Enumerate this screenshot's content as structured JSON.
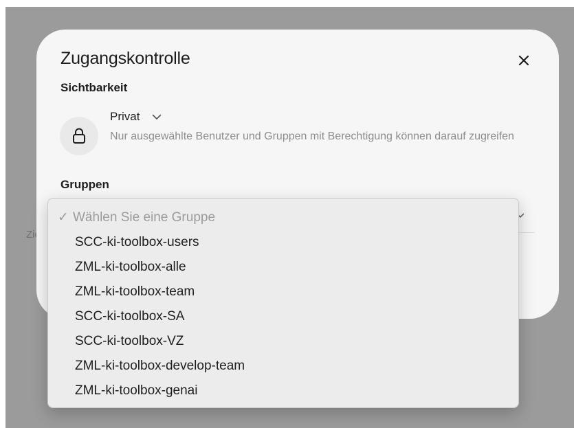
{
  "background": {
    "fragment_text": "Zie"
  },
  "modal": {
    "title": "Zugangskontrolle",
    "close_icon": "close-icon",
    "visibility": {
      "label": "Sichtbarkeit",
      "icon": "lock-icon",
      "selected": "Privat",
      "description": "Nur ausgewählte Benutzer und Gruppen mit Berechtigung können darauf zugreifen"
    },
    "groups": {
      "label": "Gruppen"
    }
  },
  "dropdown": {
    "placeholder_check": "✓",
    "placeholder": "Wählen Sie eine Gruppe",
    "options": [
      "SCC-ki-toolbox-users",
      "ZML-ki-toolbox-alle",
      "ZML-ki-toolbox-team",
      "SCC-ki-toolbox-SA",
      "SCC-ki-toolbox-VZ",
      "ZML-ki-toolbox-develop-team",
      "ZML-ki-toolbox-genai"
    ]
  },
  "colors": {
    "backdrop": "#9b9b9b",
    "modal": "#f6f6f6",
    "menu": "#ececec",
    "muted_text": "#8d8d8d"
  }
}
